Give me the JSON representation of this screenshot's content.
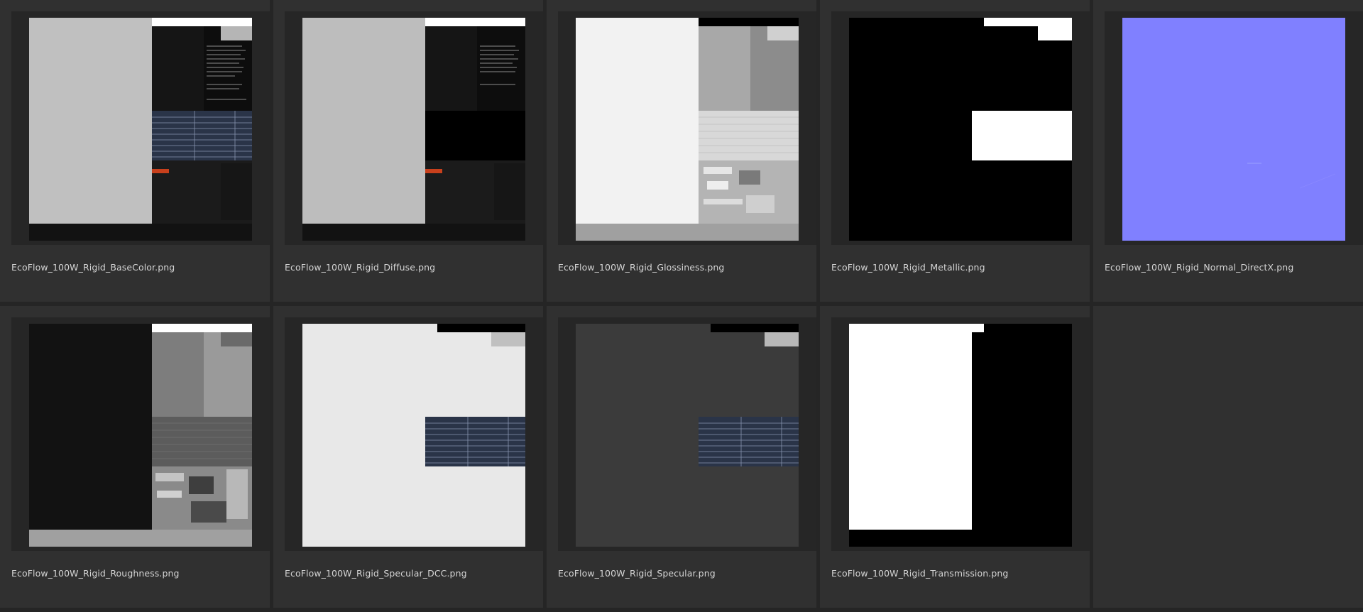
{
  "files": [
    {
      "name": "EcoFlow_100W_Rigid_BaseColor.png",
      "thumb": "basecolor"
    },
    {
      "name": "EcoFlow_100W_Rigid_Diffuse.png",
      "thumb": "diffuse"
    },
    {
      "name": "EcoFlow_100W_Rigid_Glossiness.png",
      "thumb": "glossiness"
    },
    {
      "name": "EcoFlow_100W_Rigid_Metallic.png",
      "thumb": "metallic"
    },
    {
      "name": "EcoFlow_100W_Rigid_Normal_DirectX.png",
      "thumb": "normal"
    },
    {
      "name": "EcoFlow_100W_Rigid_Roughness.png",
      "thumb": "roughness"
    },
    {
      "name": "EcoFlow_100W_Rigid_Specular_DCC.png",
      "thumb": "specular-dcc"
    },
    {
      "name": "EcoFlow_100W_Rigid_Specular.png",
      "thumb": "specular"
    },
    {
      "name": "EcoFlow_100W_Rigid_Transmission.png",
      "thumb": "transmission"
    }
  ],
  "colors": {
    "background": "#303030",
    "frame": "#262626",
    "text": "#d4d4d4",
    "normal_map_blue": "#8080ff",
    "accent_red": "#c8401c",
    "panel_blue": "#2a3448"
  }
}
